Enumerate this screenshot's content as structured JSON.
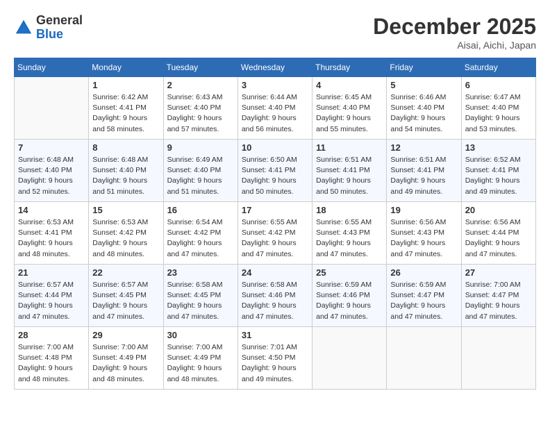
{
  "header": {
    "logo_general": "General",
    "logo_blue": "Blue",
    "month": "December 2025",
    "location": "Aisai, Aichi, Japan"
  },
  "weekdays": [
    "Sunday",
    "Monday",
    "Tuesday",
    "Wednesday",
    "Thursday",
    "Friday",
    "Saturday"
  ],
  "weeks": [
    [
      {
        "day": "",
        "info": ""
      },
      {
        "day": "1",
        "info": "Sunrise: 6:42 AM\nSunset: 4:41 PM\nDaylight: 9 hours\nand 58 minutes."
      },
      {
        "day": "2",
        "info": "Sunrise: 6:43 AM\nSunset: 4:40 PM\nDaylight: 9 hours\nand 57 minutes."
      },
      {
        "day": "3",
        "info": "Sunrise: 6:44 AM\nSunset: 4:40 PM\nDaylight: 9 hours\nand 56 minutes."
      },
      {
        "day": "4",
        "info": "Sunrise: 6:45 AM\nSunset: 4:40 PM\nDaylight: 9 hours\nand 55 minutes."
      },
      {
        "day": "5",
        "info": "Sunrise: 6:46 AM\nSunset: 4:40 PM\nDaylight: 9 hours\nand 54 minutes."
      },
      {
        "day": "6",
        "info": "Sunrise: 6:47 AM\nSunset: 4:40 PM\nDaylight: 9 hours\nand 53 minutes."
      }
    ],
    [
      {
        "day": "7",
        "info": "Sunrise: 6:48 AM\nSunset: 4:40 PM\nDaylight: 9 hours\nand 52 minutes."
      },
      {
        "day": "8",
        "info": "Sunrise: 6:48 AM\nSunset: 4:40 PM\nDaylight: 9 hours\nand 51 minutes."
      },
      {
        "day": "9",
        "info": "Sunrise: 6:49 AM\nSunset: 4:40 PM\nDaylight: 9 hours\nand 51 minutes."
      },
      {
        "day": "10",
        "info": "Sunrise: 6:50 AM\nSunset: 4:41 PM\nDaylight: 9 hours\nand 50 minutes."
      },
      {
        "day": "11",
        "info": "Sunrise: 6:51 AM\nSunset: 4:41 PM\nDaylight: 9 hours\nand 50 minutes."
      },
      {
        "day": "12",
        "info": "Sunrise: 6:51 AM\nSunset: 4:41 PM\nDaylight: 9 hours\nand 49 minutes."
      },
      {
        "day": "13",
        "info": "Sunrise: 6:52 AM\nSunset: 4:41 PM\nDaylight: 9 hours\nand 49 minutes."
      }
    ],
    [
      {
        "day": "14",
        "info": "Sunrise: 6:53 AM\nSunset: 4:41 PM\nDaylight: 9 hours\nand 48 minutes."
      },
      {
        "day": "15",
        "info": "Sunrise: 6:53 AM\nSunset: 4:42 PM\nDaylight: 9 hours\nand 48 minutes."
      },
      {
        "day": "16",
        "info": "Sunrise: 6:54 AM\nSunset: 4:42 PM\nDaylight: 9 hours\nand 47 minutes."
      },
      {
        "day": "17",
        "info": "Sunrise: 6:55 AM\nSunset: 4:42 PM\nDaylight: 9 hours\nand 47 minutes."
      },
      {
        "day": "18",
        "info": "Sunrise: 6:55 AM\nSunset: 4:43 PM\nDaylight: 9 hours\nand 47 minutes."
      },
      {
        "day": "19",
        "info": "Sunrise: 6:56 AM\nSunset: 4:43 PM\nDaylight: 9 hours\nand 47 minutes."
      },
      {
        "day": "20",
        "info": "Sunrise: 6:56 AM\nSunset: 4:44 PM\nDaylight: 9 hours\nand 47 minutes."
      }
    ],
    [
      {
        "day": "21",
        "info": "Sunrise: 6:57 AM\nSunset: 4:44 PM\nDaylight: 9 hours\nand 47 minutes."
      },
      {
        "day": "22",
        "info": "Sunrise: 6:57 AM\nSunset: 4:45 PM\nDaylight: 9 hours\nand 47 minutes."
      },
      {
        "day": "23",
        "info": "Sunrise: 6:58 AM\nSunset: 4:45 PM\nDaylight: 9 hours\nand 47 minutes."
      },
      {
        "day": "24",
        "info": "Sunrise: 6:58 AM\nSunset: 4:46 PM\nDaylight: 9 hours\nand 47 minutes."
      },
      {
        "day": "25",
        "info": "Sunrise: 6:59 AM\nSunset: 4:46 PM\nDaylight: 9 hours\nand 47 minutes."
      },
      {
        "day": "26",
        "info": "Sunrise: 6:59 AM\nSunset: 4:47 PM\nDaylight: 9 hours\nand 47 minutes."
      },
      {
        "day": "27",
        "info": "Sunrise: 7:00 AM\nSunset: 4:47 PM\nDaylight: 9 hours\nand 47 minutes."
      }
    ],
    [
      {
        "day": "28",
        "info": "Sunrise: 7:00 AM\nSunset: 4:48 PM\nDaylight: 9 hours\nand 48 minutes."
      },
      {
        "day": "29",
        "info": "Sunrise: 7:00 AM\nSunset: 4:49 PM\nDaylight: 9 hours\nand 48 minutes."
      },
      {
        "day": "30",
        "info": "Sunrise: 7:00 AM\nSunset: 4:49 PM\nDaylight: 9 hours\nand 48 minutes."
      },
      {
        "day": "31",
        "info": "Sunrise: 7:01 AM\nSunset: 4:50 PM\nDaylight: 9 hours\nand 49 minutes."
      },
      {
        "day": "",
        "info": ""
      },
      {
        "day": "",
        "info": ""
      },
      {
        "day": "",
        "info": ""
      }
    ]
  ]
}
